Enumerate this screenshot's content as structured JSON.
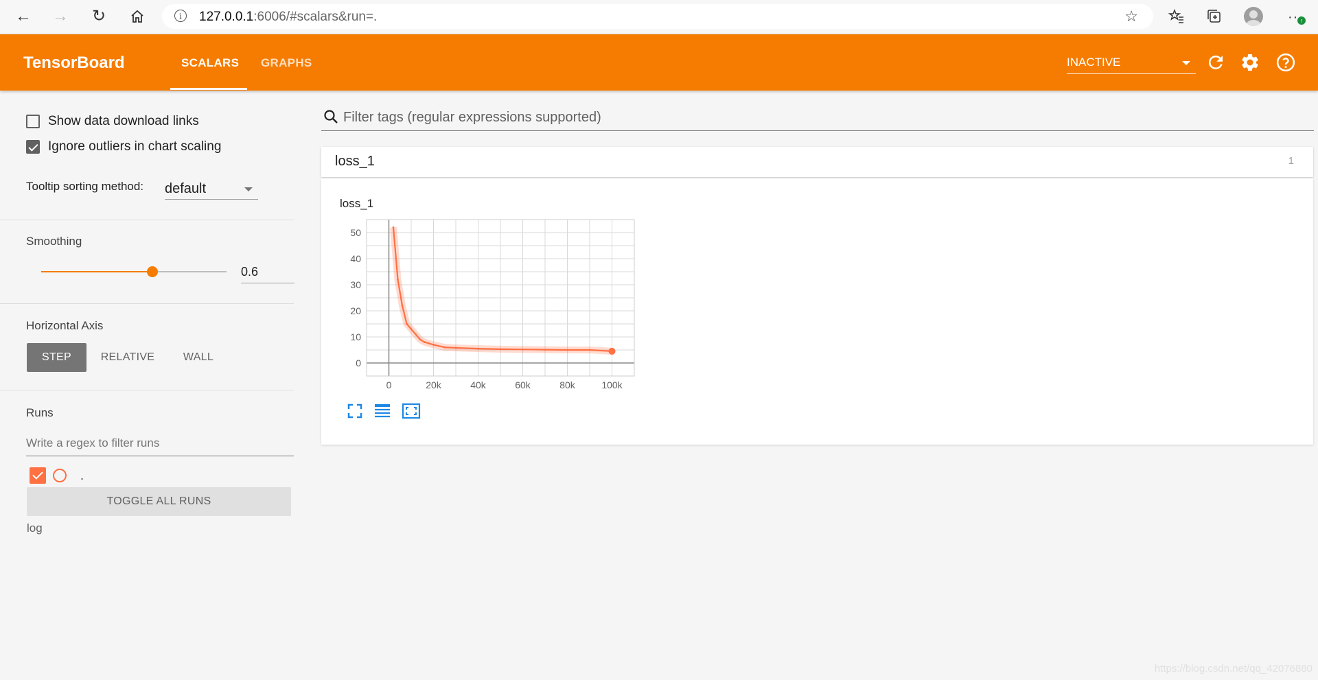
{
  "browser": {
    "url_host": "127.0.0.1",
    "url_rest": ":6006/#scalars&run=.",
    "icons": [
      "back-icon",
      "forward-icon",
      "refresh-icon",
      "home-icon",
      "info-icon",
      "favorite-add-icon",
      "favorites-icon",
      "collections-icon",
      "profile-icon",
      "more-icon"
    ]
  },
  "header": {
    "logo": "TensorBoard",
    "tabs": [
      {
        "label": "SCALARS",
        "active": true
      },
      {
        "label": "GRAPHS",
        "active": false
      }
    ],
    "run_selector": "INACTIVE",
    "brand_color": "#f57c00"
  },
  "sidebar": {
    "show_download_links": {
      "label": "Show data download links",
      "checked": false
    },
    "ignore_outliers": {
      "label": "Ignore outliers in chart scaling",
      "checked": true
    },
    "tooltip_sorting_label": "Tooltip sorting method:",
    "tooltip_sorting_value": "default",
    "smoothing_label": "Smoothing",
    "smoothing_value": "0.6",
    "smoothing_fraction": 0.6,
    "horizontal_axis_label": "Horizontal Axis",
    "axis_options": [
      "STEP",
      "RELATIVE",
      "WALL"
    ],
    "axis_selected": "STEP",
    "runs_label": "Runs",
    "runs_filter_placeholder": "Write a regex to filter runs",
    "runs": [
      {
        "name": ".",
        "checked": true,
        "color": "#ff7043"
      }
    ],
    "toggle_all_label": "TOGGLE ALL RUNS",
    "log_dir": "log"
  },
  "main": {
    "filter_placeholder": "Filter tags (regular expressions supported)",
    "category_name": "loss_1",
    "category_count": "1",
    "card_title": "loss_1"
  },
  "chart_data": {
    "type": "line",
    "title": "loss_1",
    "xlabel": "",
    "ylabel": "",
    "x_ticks": [
      "0",
      "20k",
      "40k",
      "60k",
      "80k",
      "100k"
    ],
    "y_ticks": [
      "0",
      "10",
      "20",
      "30",
      "40",
      "50"
    ],
    "xlim": [
      -10000,
      110000
    ],
    "ylim": [
      -5,
      55
    ],
    "grid": true,
    "series": [
      {
        "color": "#ff7043",
        "x": [
          2000,
          4000,
          6000,
          8000,
          10000,
          12000,
          14000,
          16000,
          18000,
          20000,
          25000,
          30000,
          40000,
          50000,
          60000,
          70000,
          80000,
          90000,
          100000
        ],
        "values": [
          52,
          32,
          22,
          15,
          13,
          11,
          9,
          8,
          7.5,
          7,
          6,
          5.8,
          5.5,
          5.3,
          5.2,
          5.1,
          5.0,
          5.0,
          4.5
        ]
      }
    ]
  },
  "watermark": "https://blog.csdn.net/qq_42076880"
}
